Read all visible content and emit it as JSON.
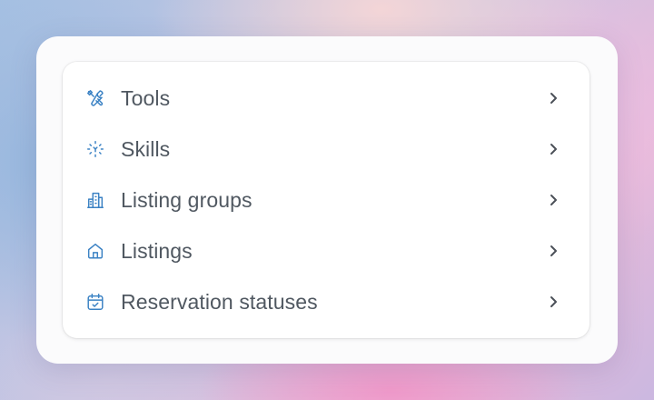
{
  "menu": {
    "items": [
      {
        "label": "Tools",
        "icon": "tools-icon"
      },
      {
        "label": "Skills",
        "icon": "skills-icon"
      },
      {
        "label": "Listing groups",
        "icon": "building-icon"
      },
      {
        "label": "Listings",
        "icon": "house-icon"
      },
      {
        "label": "Reservation statuses",
        "icon": "calendar-check-icon"
      }
    ]
  },
  "colors": {
    "icon_accent": "#3b82c4",
    "label_text": "#505861",
    "chevron": "#4b5058"
  }
}
